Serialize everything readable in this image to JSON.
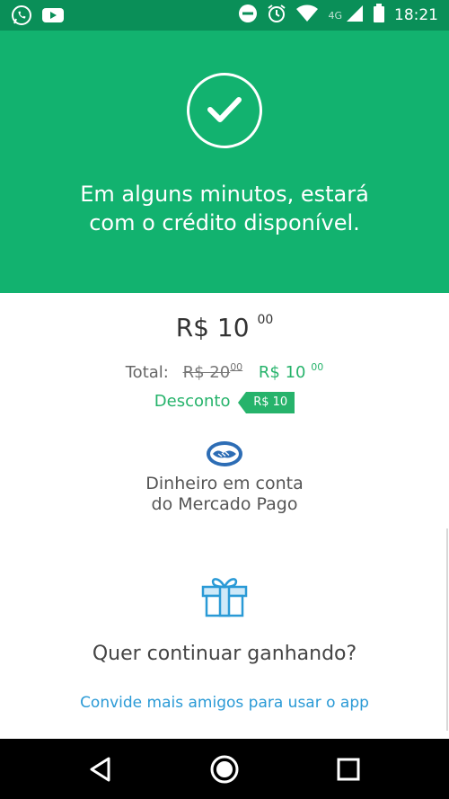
{
  "status_bar": {
    "left_icons": [
      "whatsapp-icon",
      "youtube-icon"
    ],
    "right_icons": [
      "do-not-disturb-icon",
      "alarm-icon",
      "wifi-icon",
      "signal-icon",
      "battery-icon"
    ],
    "network": "4G",
    "time": "18:21",
    "color": "#0a8f58"
  },
  "hero": {
    "background": "#12b26f",
    "icon": "check-icon",
    "message": "Em alguns minutos, estará\ncom o crédito disponível."
  },
  "summary": {
    "amount_main": "R$ 10",
    "amount_cents": "00",
    "total_label": "Total:",
    "original_main": "R$ 20",
    "original_cents": "00",
    "final_main": "R$ 10",
    "final_cents": "00",
    "discount_label": "Desconto",
    "discount_tag": "R$ 10",
    "accent_color": "#26b36b"
  },
  "payment": {
    "logo": "mercado-pago-handshake-icon",
    "method": "Dinheiro em conta\ndo Mercado Pago"
  },
  "promo": {
    "icon": "gift-icon",
    "title": "Quer continuar ganhando?",
    "link": "Convide mais amigos para usar o app",
    "link_color": "#2a9ad6"
  },
  "nav_bar": {
    "buttons": [
      "back-icon",
      "home-icon",
      "recents-icon"
    ]
  }
}
